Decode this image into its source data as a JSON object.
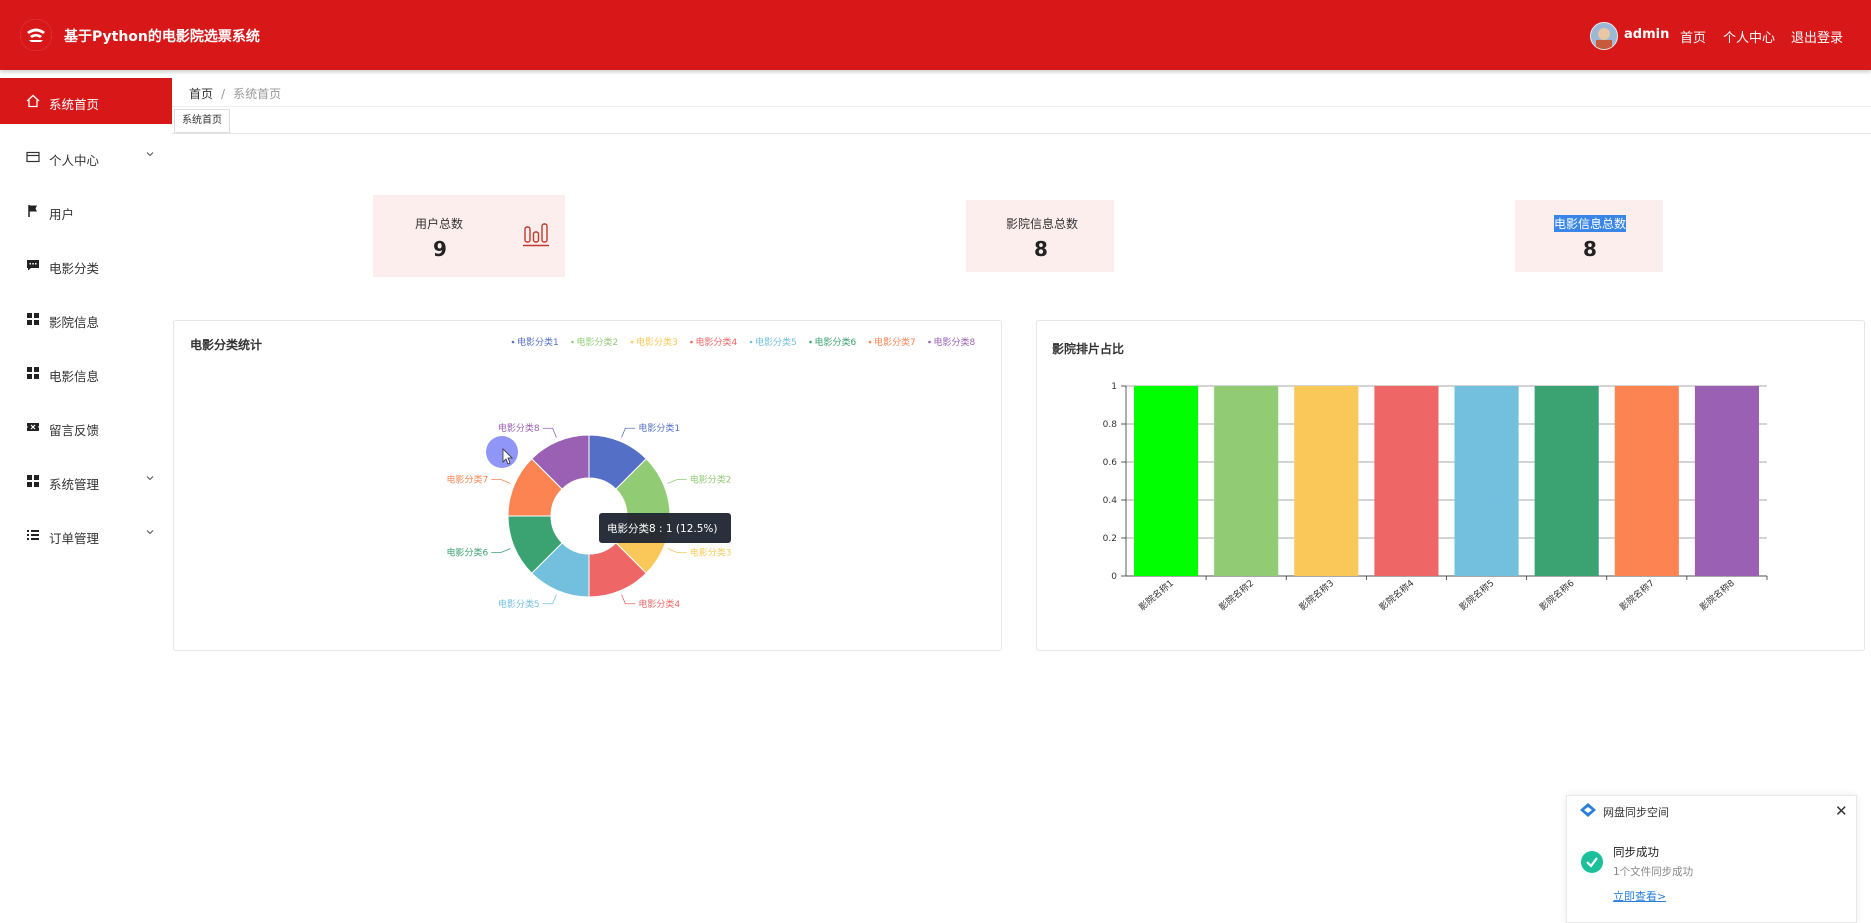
{
  "header": {
    "app_title": "基于Python的电影院选票系统",
    "username": "admin",
    "links": [
      "首页",
      "个人中心",
      "退出登录"
    ]
  },
  "sidebar": {
    "items": [
      {
        "label": "系统首页",
        "icon": "home-icon",
        "active": true
      },
      {
        "label": "个人中心",
        "icon": "card-icon",
        "expandable": true
      },
      {
        "label": "用户",
        "icon": "flag-icon"
      },
      {
        "label": "电影分类",
        "icon": "chat-icon"
      },
      {
        "label": "影院信息",
        "icon": "grid-icon"
      },
      {
        "label": "电影信息",
        "icon": "grid-icon"
      },
      {
        "label": "留言反馈",
        "icon": "ticket-icon"
      },
      {
        "label": "系统管理",
        "icon": "grid-icon",
        "expandable": true
      },
      {
        "label": "订单管理",
        "icon": "list-icon",
        "expandable": true
      }
    ]
  },
  "breadcrumb": {
    "home": "首页",
    "separator": "/",
    "current": "系统首页"
  },
  "tabs": [
    {
      "label": "系统首页"
    }
  ],
  "stats": [
    {
      "label": "用户总数",
      "value": "9",
      "icon": "bar-chart-icon"
    },
    {
      "label": "影院信息总数",
      "value": "8"
    },
    {
      "label": "电影信息总数",
      "value": "8"
    }
  ],
  "colors": {
    "primary": "#d81818",
    "stat_bg": "#fdeeee",
    "pie": [
      "#5470c6",
      "#91cc75",
      "#fac858",
      "#ee6666",
      "#73c0de",
      "#3ba272",
      "#fc8452",
      "#9a60b4"
    ],
    "bars": [
      "#00ff00",
      "#91cc75",
      "#fac858",
      "#ee6666",
      "#73c0de",
      "#3ba272",
      "#fc8452",
      "#9a60b4"
    ]
  },
  "chart_data": [
    {
      "type": "pie",
      "title": "电影分类统计",
      "legend_position": "top-right",
      "labels": [
        "电影分类1",
        "电影分类2",
        "电影分类3",
        "电影分类4",
        "电影分类5",
        "电影分类6",
        "电影分类7",
        "电影分类8"
      ],
      "values": [
        1,
        1,
        1,
        1,
        1,
        1,
        1,
        1
      ],
      "donut": true,
      "tooltip": "电影分类8 : 1 (12.5%)"
    },
    {
      "type": "bar",
      "title": "影院排片占比",
      "categories": [
        "影院名称1",
        "影院名称2",
        "影院名称3",
        "影院名称4",
        "影院名称5",
        "影院名称6",
        "影院名称7",
        "影院名称8"
      ],
      "values": [
        1,
        1,
        1,
        1,
        1,
        1,
        1,
        1
      ],
      "ylim": [
        0,
        1
      ],
      "yticks": [
        "0",
        "0.2",
        "0.4",
        "0.6",
        "0.8",
        "1"
      ],
      "grid": true
    }
  ],
  "toast": {
    "title": "网盘同步空间",
    "status": "同步成功",
    "detail": "1个文件同步成功",
    "link": "立即查看>"
  }
}
